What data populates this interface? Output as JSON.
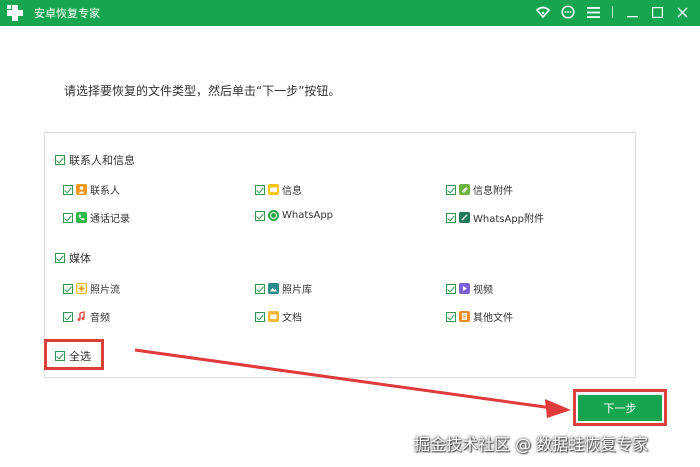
{
  "window": {
    "title": "安卓恢复专家",
    "accent_color": "#17a64f",
    "controls": [
      "wifi-icon",
      "chat-icon",
      "menu-icon",
      "minimize-icon",
      "maximize-icon",
      "close-icon"
    ]
  },
  "instruction": "请选择要恢复的文件类型，然后单击“下一步”按钮。",
  "groups": {
    "contacts": {
      "label": "联系人和信息",
      "checked": true,
      "items": [
        {
          "label": "联系人",
          "icon": "contact-icon",
          "checked": true
        },
        {
          "label": "信息",
          "icon": "message-icon",
          "checked": true
        },
        {
          "label": "信息附件",
          "icon": "attachment-icon",
          "checked": true
        },
        {
          "label": "通话记录",
          "icon": "phone-icon",
          "checked": true
        },
        {
          "label": "WhatsApp",
          "icon": "whatsapp-icon",
          "checked": true
        },
        {
          "label": "WhatsApp附件",
          "icon": "whatsapp-attachment-icon",
          "checked": true
        }
      ]
    },
    "media": {
      "label": "媒体",
      "checked": true,
      "items": [
        {
          "label": "照片流",
          "icon": "photo-stream-icon",
          "checked": true
        },
        {
          "label": "照片库",
          "icon": "photo-library-icon",
          "checked": true
        },
        {
          "label": "视频",
          "icon": "video-icon",
          "checked": true
        },
        {
          "label": "音频",
          "icon": "audio-icon",
          "checked": true
        },
        {
          "label": "文档",
          "icon": "document-icon",
          "checked": true
        },
        {
          "label": "其他文件",
          "icon": "other-files-icon",
          "checked": true
        }
      ]
    }
  },
  "select_all": {
    "label": "全选",
    "checked": true
  },
  "next_button": {
    "label": "下一步"
  },
  "highlight_color": "#d9403a",
  "watermark": "掘金技术社区 @ 数据蛙恢复专家"
}
